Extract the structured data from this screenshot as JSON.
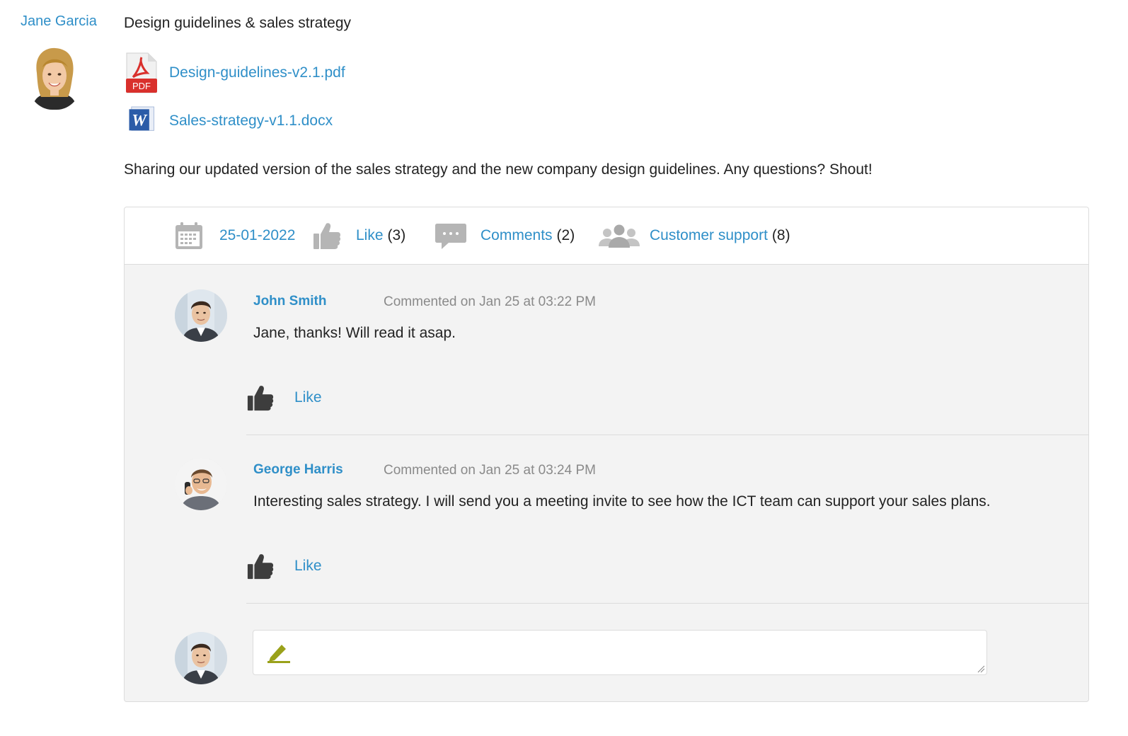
{
  "post": {
    "author": "Jane Garcia",
    "title": "Design guidelines & sales strategy",
    "attachments": [
      {
        "name": "Design-guidelines-v2.1.pdf",
        "type": "pdf-icon",
        "badge": "PDF"
      },
      {
        "name": "Sales-strategy-v1.1.docx",
        "type": "word-icon",
        "badge": "W"
      }
    ],
    "body": "Sharing our updated version of the sales strategy and the new company design guidelines. Any questions? Shout!"
  },
  "meta": {
    "date": "25-01-2022",
    "like_label": "Like",
    "like_count": "(3)",
    "comments_label": "Comments",
    "comments_count": "(2)",
    "group_label": "Customer support",
    "group_count": "(8)"
  },
  "comments": [
    {
      "author": "John Smith",
      "time": "Commented on Jan 25 at 03:22 PM",
      "text": "Jane, thanks! Will read it asap.",
      "like_label": "Like"
    },
    {
      "author": "George Harris",
      "time": "Commented on Jan 25 at 03:24 PM",
      "text": "Interesting sales strategy. I will send you a meeting invite to see how the ICT team can support your sales plans.",
      "like_label": "Like"
    }
  ],
  "colors": {
    "link": "#2f8fc8",
    "pdf_red": "#d9302c",
    "word_blue": "#2b5ca8",
    "icon_gray": "#b5b5b5",
    "pencil": "#9aa11a"
  }
}
